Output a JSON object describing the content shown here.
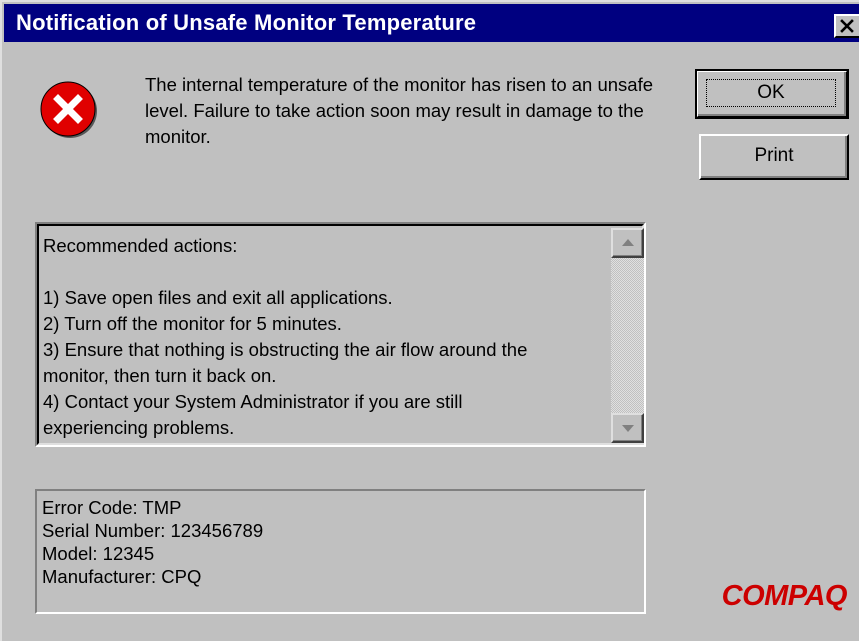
{
  "window": {
    "title": "Notification of Unsafe Monitor Temperature",
    "close_glyph": "✕"
  },
  "message": "The internal temperature of the monitor has risen to an unsafe level.  Failure to take action soon may result in damage to the monitor.",
  "buttons": {
    "ok_label": "OK",
    "print_label": "Print"
  },
  "actions": {
    "lines": [
      "Recommended actions:",
      "",
      "1) Save open files and exit all applications.",
      "2) Turn off the monitor for 5 minutes.",
      "3) Ensure that nothing is obstructing the air flow around the",
      "monitor, then turn it back on.",
      "4) Contact your System Administrator if you are still",
      "experiencing problems."
    ]
  },
  "info": {
    "error_code": "Error Code: TMP",
    "serial_number": "Serial Number: 123456789",
    "model": "Model: 12345",
    "manufacturer": "Manufacturer: CPQ"
  },
  "logo": {
    "text": "COMPAQ",
    "color": "#cc0000"
  },
  "icons": {
    "error": "error-icon",
    "close": "close-icon",
    "scroll_up": "scroll-up-arrow-icon",
    "scroll_down": "scroll-down-arrow-icon"
  },
  "colors": {
    "titlebar": "#000080",
    "face": "#c0c0c0",
    "error_red": "#e00000"
  }
}
